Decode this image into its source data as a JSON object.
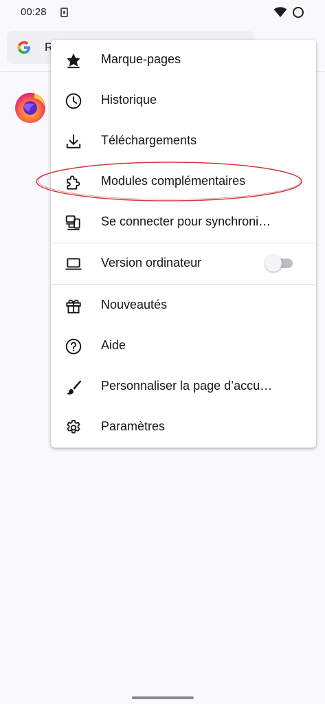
{
  "status_bar": {
    "time": "00:28"
  },
  "url_bar": {
    "text": "R"
  },
  "menu": {
    "items": [
      {
        "label": "Marque-pages",
        "icon": "bookmark-star-icon"
      },
      {
        "label": "Historique",
        "icon": "history-clock-icon"
      },
      {
        "label": "Téléchargements",
        "icon": "download-icon"
      },
      {
        "label": "Modules complémentaires",
        "icon": "addon-puzzle-icon"
      },
      {
        "label": "Se connecter pour synchroni…",
        "icon": "sync-devices-icon"
      },
      {
        "label": "Version ordinateur",
        "icon": "laptop-icon",
        "toggle": false
      },
      {
        "label": "Nouveautés",
        "icon": "gift-icon"
      },
      {
        "label": "Aide",
        "icon": "help-icon"
      },
      {
        "label": "Personnaliser la page d’accu…",
        "icon": "brush-icon"
      },
      {
        "label": "Paramètres",
        "icon": "gear-icon"
      }
    ]
  },
  "colors": {
    "background": "#f9f9fb",
    "menu_background": "#ffffff",
    "text": "#15141a",
    "highlight": "#d33b3b"
  }
}
